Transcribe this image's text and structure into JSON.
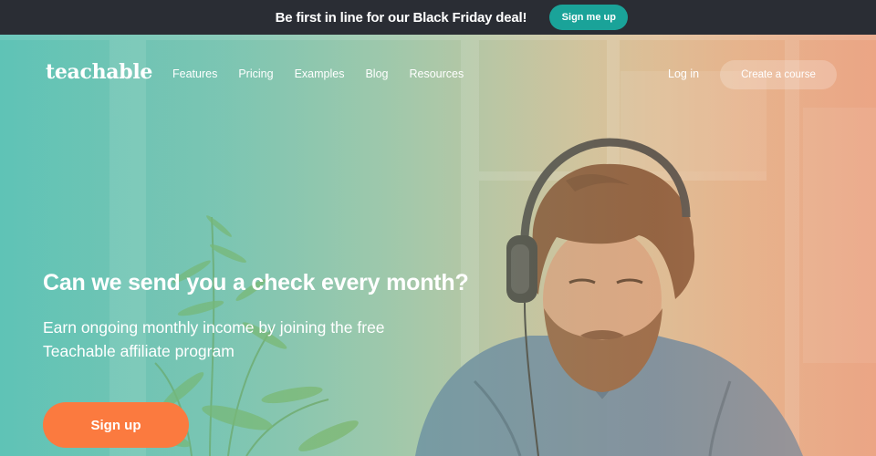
{
  "promo": {
    "text": "Be first in line for our Black Friday deal!",
    "button_label": "Sign me up"
  },
  "nav": {
    "logo": "teachable",
    "links": [
      {
        "label": "Features"
      },
      {
        "label": "Pricing"
      },
      {
        "label": "Examples"
      },
      {
        "label": "Blog"
      },
      {
        "label": "Resources"
      }
    ],
    "login_label": "Log in",
    "create_label": "Create a course"
  },
  "hero": {
    "headline": "Can we send you a check every month?",
    "subhead": "Earn ongoing monthly income by joining the free Teachable affiliate program",
    "signup_label": "Sign up"
  },
  "colors": {
    "promo_bar": "#2a2d34",
    "promo_button": "#1aa399",
    "signup_button": "#fb7a3f",
    "gradient_left": "#5fc3b6",
    "gradient_right": "#eba585"
  }
}
